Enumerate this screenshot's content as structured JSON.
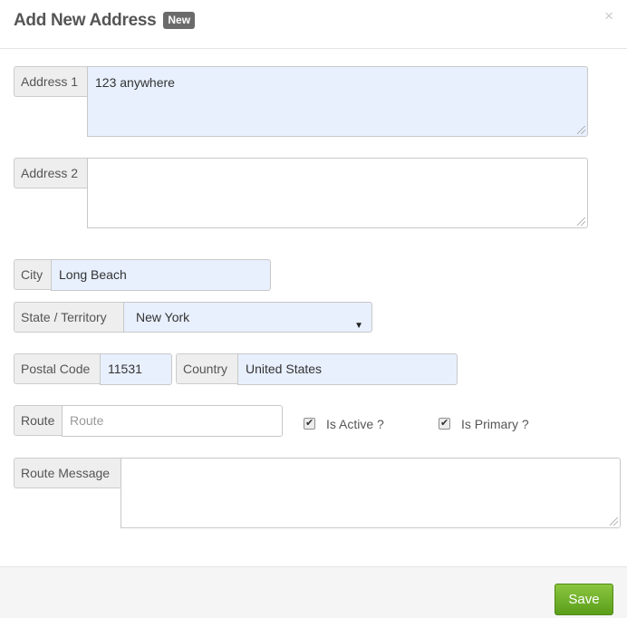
{
  "modal": {
    "title": "Add New Address",
    "badge": "New",
    "close_glyph": "×"
  },
  "form": {
    "address1": {
      "label": "Address 1",
      "value": "123 anywhere"
    },
    "address2": {
      "label": "Address 2",
      "value": ""
    },
    "city": {
      "label": "City",
      "value": "Long Beach"
    },
    "state": {
      "label": "State / Territory",
      "value": "New York",
      "arrow": "▼"
    },
    "postal_code": {
      "label": "Postal Code",
      "value": "11531"
    },
    "country": {
      "label": "Country",
      "value": "United States"
    },
    "route": {
      "label": "Route",
      "value": "",
      "placeholder": "Route"
    },
    "is_active": {
      "label": "Is Active ?",
      "checked": true,
      "tick": "✔"
    },
    "is_primary": {
      "label": "Is Primary ?",
      "checked": true,
      "tick": "✔"
    },
    "route_message": {
      "label": "Route Message",
      "value": ""
    }
  },
  "footer": {
    "save_label": "Save"
  },
  "colors": {
    "filled_field": "#e8f0fe",
    "save_button": "#6fb02a"
  }
}
